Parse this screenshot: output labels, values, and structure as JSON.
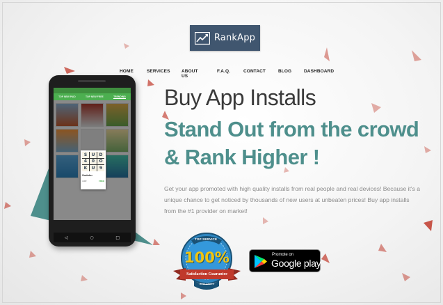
{
  "brand": {
    "name": "RankApp"
  },
  "nav": {
    "items": [
      "HOME",
      "SERVICES",
      "ABOUT US",
      "F.A.Q.",
      "CONTACT",
      "BLOG",
      "DASHBOARD"
    ]
  },
  "phone": {
    "tabs": [
      "TOP NEW PAID",
      "TOP NEW FREE",
      "TRENDING"
    ],
    "popup": {
      "grid": [
        "S",
        "U",
        "D",
        "4",
        "0",
        "O",
        "K",
        "U",
        "9"
      ],
      "title": "Sudoku",
      "rating": "4.0★",
      "price": "FREE"
    },
    "navbar": [
      "◁",
      "○",
      "□"
    ]
  },
  "hero": {
    "title": "Buy App Installs",
    "headline": "Stand Out from the crowd & Rank Higher !",
    "description": "Get your app promoted with high quality installs from real people and real devices! Because it's a unique chance to get noticed by thousands of new users at unbeaten prices! Buy app installs from the #1 provider on market!"
  },
  "badge": {
    "top": "TOP SERVICE",
    "percent": "100%",
    "ribbon": "Satisfaction Guarantee",
    "bottom": "Best Choice"
  },
  "google_play": {
    "small": "Promote on",
    "big": "Google play"
  },
  "colors": {
    "brand_bg": "#40566f",
    "accent_teal": "#4e8f8c",
    "confetti": "#c0392b"
  }
}
